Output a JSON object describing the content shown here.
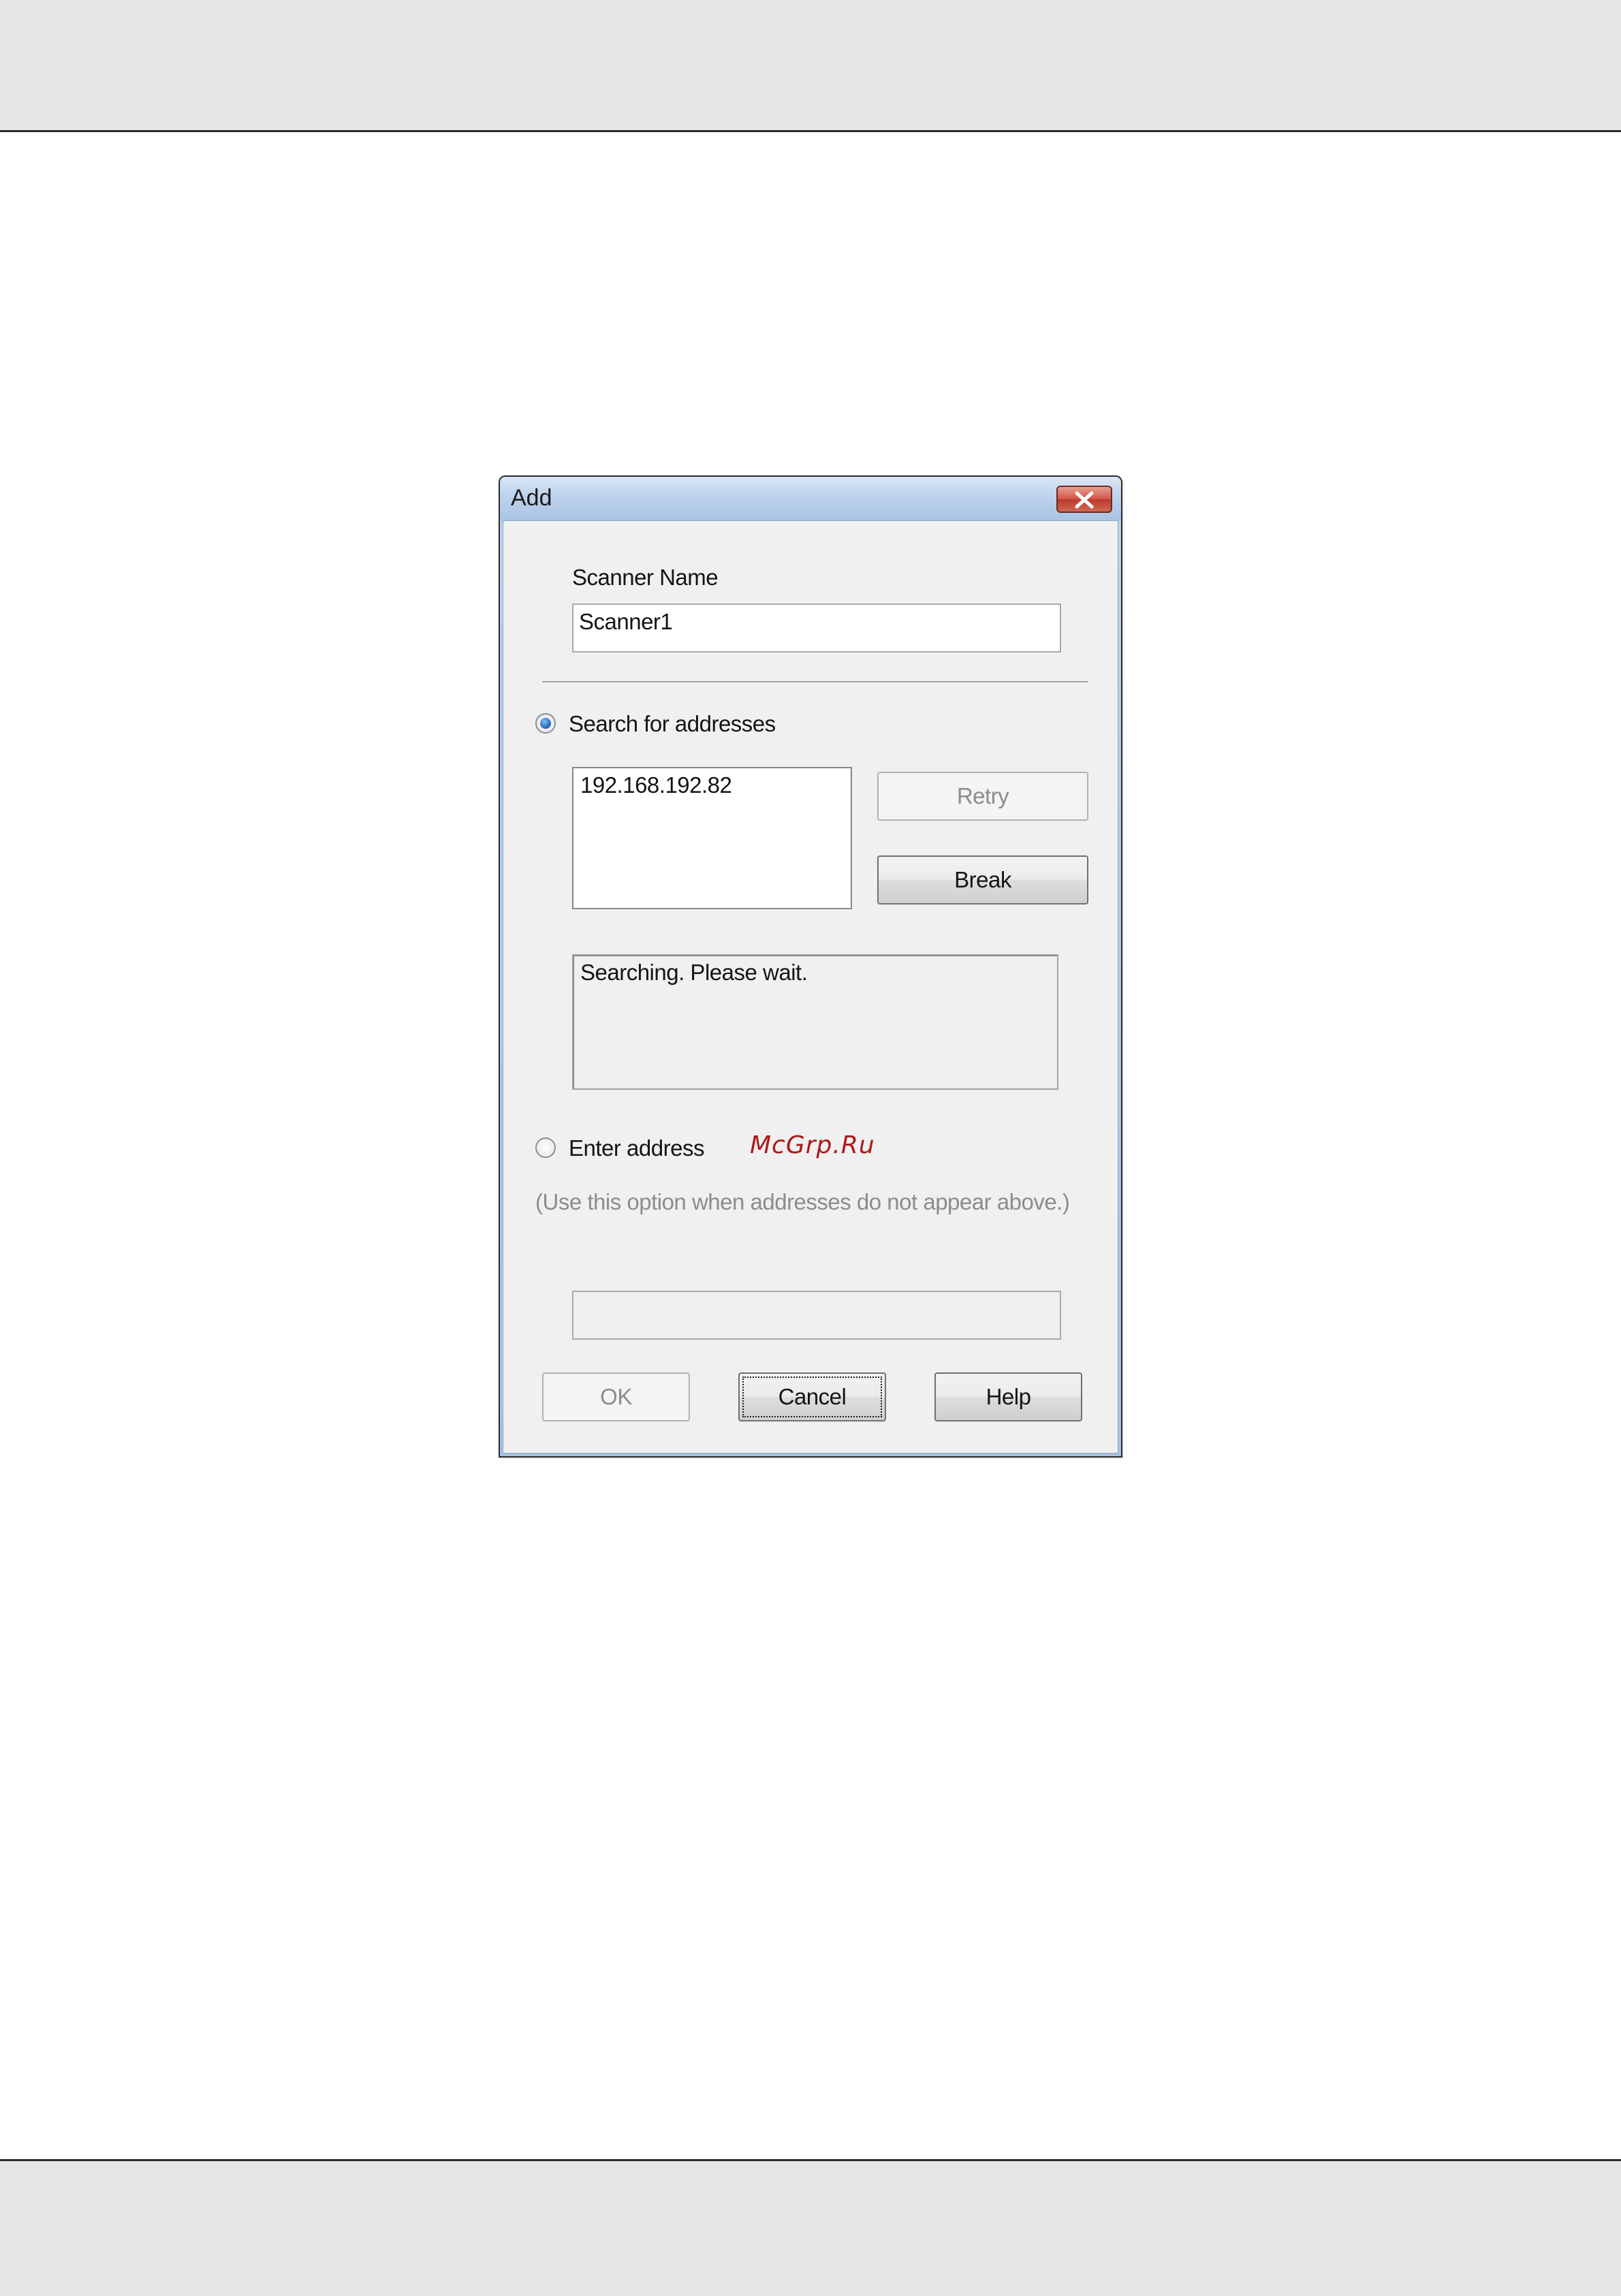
{
  "dialog": {
    "title": "Add",
    "close_icon": "close-x-icon",
    "scanner_name": {
      "label": "Scanner Name",
      "value": "Scanner1"
    },
    "search_option": {
      "label": "Search for addresses",
      "selected": true
    },
    "address_list": {
      "items": [
        "192.168.192.82"
      ]
    },
    "retry_label": "Retry",
    "break_label": "Break",
    "status_text": "Searching. Please wait.",
    "enter_option": {
      "label": "Enter address",
      "selected": false,
      "hint": "(Use this option when addresses do not appear above.)",
      "value": ""
    },
    "buttons": {
      "ok": "OK",
      "cancel": "Cancel",
      "help": "Help"
    }
  },
  "watermark": "McGrp.Ru",
  "colors": {
    "titlebar": "#bdd2ec",
    "close_button": "#d0574a",
    "client_background": "#f0f0f0",
    "radio_selected": "#1c63b7",
    "watermark": "#b01818"
  }
}
